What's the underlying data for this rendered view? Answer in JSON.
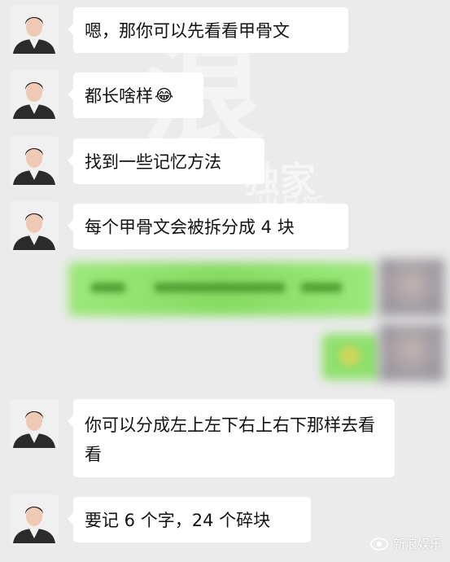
{
  "watermark": {
    "big_char": "浪",
    "side_text": "独家",
    "small_text": "出品新"
  },
  "messages": [
    {
      "text": "嗯，那你可以先看看甲骨文"
    },
    {
      "text": "都长啥样",
      "emoji": "😂"
    },
    {
      "text": "找到一些记忆方法"
    },
    {
      "text": "每个甲骨文会被拆分成 4 块"
    },
    {
      "text": "你可以分成左上左下右上右下那样去看看"
    },
    {
      "text": "要记 6 个字，24 个碎块"
    }
  ],
  "brand": {
    "label": "新浪娱乐",
    "icon": "weibo-eye-icon"
  },
  "colors": {
    "background": "#ebebeb",
    "bubble_in": "#ffffff",
    "bubble_out_blurred": "#95e36f"
  }
}
